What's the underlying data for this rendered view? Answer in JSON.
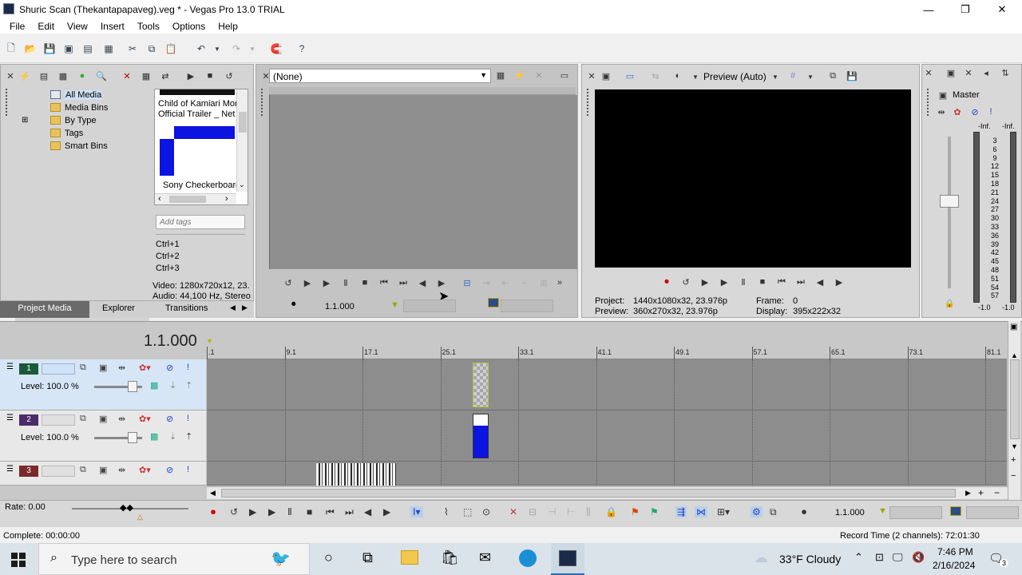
{
  "window": {
    "title": "Shuric Scan (Thekantapapaveg).veg * - Vegas Pro 13.0 TRIAL",
    "min": "—",
    "max": "❐",
    "close": "✕"
  },
  "menu": [
    "File",
    "Edit",
    "View",
    "Insert",
    "Tools",
    "Options",
    "Help"
  ],
  "media_tree": [
    "All Media",
    "Media Bins",
    "By Type",
    "Tags",
    "Smart Bins"
  ],
  "media_thumbs": {
    "first": "Child of Kamiari Mon",
    "first2": "Official Trailer _ Net",
    "second": "Sony Checkerboard"
  },
  "tags": {
    "placeholder": "Add tags",
    "shortcuts": [
      "Ctrl+1",
      "Ctrl+2",
      "Ctrl+3"
    ]
  },
  "media_info": {
    "video": "Video: 1280x720x12, 23.",
    "audio": "Audio: 44,100 Hz, Stereo"
  },
  "tabs": [
    "Project Media",
    "Explorer",
    "Transitions"
  ],
  "trimmer": {
    "dropdown": "(None)",
    "time": "1.1.000"
  },
  "preview": {
    "mode": "Preview (Auto)",
    "project_label": "Project:",
    "project_value": "1440x1080x32, 23.976p",
    "preview_label": "Preview:",
    "preview_value": "360x270x32, 23.976p",
    "frame_label": "Frame:",
    "frame_value": "0",
    "display_label": "Display:",
    "display_value": "395x222x32"
  },
  "master": {
    "label": "Master",
    "inf_left": "-Inf.",
    "inf_right": "-Inf.",
    "scale": [
      "3",
      "6",
      "9",
      "12",
      "15",
      "18",
      "21",
      "24",
      "27",
      "30",
      "33",
      "36",
      "39",
      "42",
      "45",
      "48",
      "51",
      "54",
      "57"
    ],
    "bottom_left": "-1.0",
    "bottom_right": "-1.0"
  },
  "timeline": {
    "time": "1.1.000",
    "ruler": [
      ".1",
      "9.1",
      "17.1",
      "25.1",
      "33.1",
      "41.1",
      "49.1",
      "57.1",
      "65.1",
      "73.1",
      "81.1"
    ]
  },
  "tracks": [
    {
      "num": "1",
      "level": "Level: 100.0 %",
      "color": "#1a5a3a"
    },
    {
      "num": "2",
      "level": "Level: 100.0 %",
      "color": "#4a2a6a"
    },
    {
      "num": "3",
      "color": "#7a2a2a"
    }
  ],
  "transport": {
    "rate": "Rate: 0.00",
    "time": "1.1.000"
  },
  "status": {
    "complete": "Complete: 00:00:00",
    "record": "Record Time (2 channels): 72:01:30"
  },
  "taskbar": {
    "search": "Type here to search",
    "weather": "33°F  Cloudy",
    "time": "7:46 PM",
    "date": "2/16/2024",
    "notif": "3"
  }
}
